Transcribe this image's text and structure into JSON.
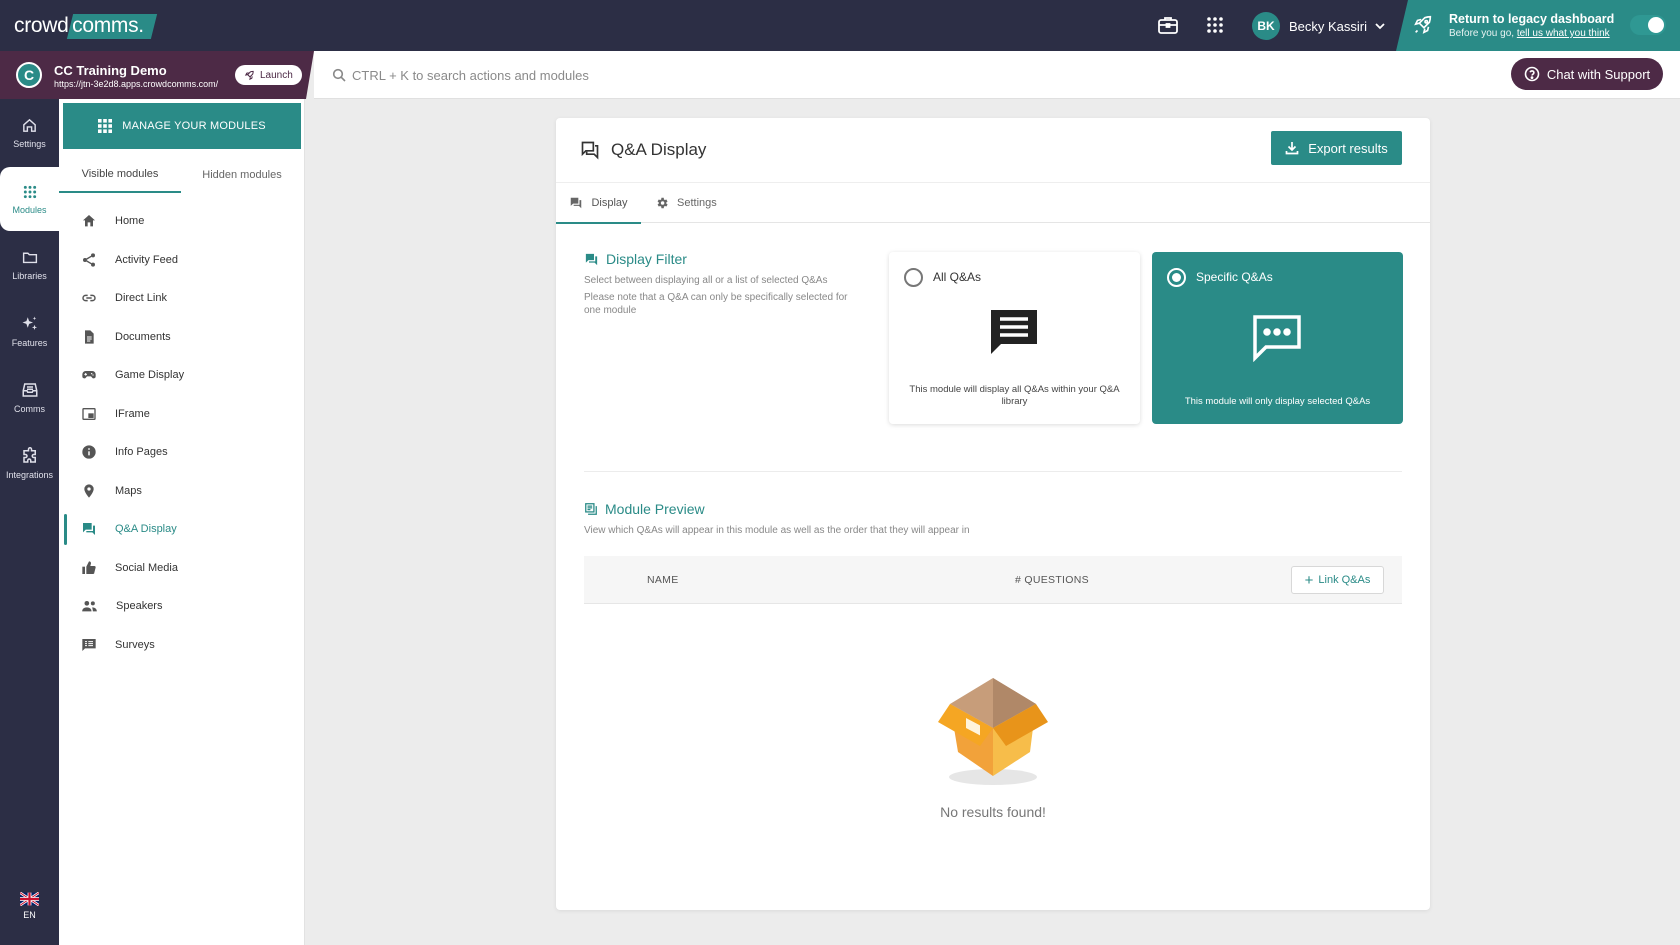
{
  "brand": {
    "logo_part1": "crowd",
    "logo_part2": "comms.",
    "accent": "#2a8b87",
    "topbar": "#2c2e45",
    "workspace_bg": "#4d2a46"
  },
  "topbar": {
    "user_initials": "BK",
    "user_name": "Becky Kassiri",
    "legacy_title": "Return to legacy dashboard",
    "legacy_sub_prefix": "Before you go, ",
    "legacy_sub_link": "tell us what you think"
  },
  "workspace": {
    "logo_letter": "C",
    "name": "CC Training Demo",
    "url": "https://jtn-3e2d8.apps.crowdcomms.com/",
    "launch_label": "Launch"
  },
  "search": {
    "placeholder": "CTRL + K to search actions and modules",
    "value": ""
  },
  "support": {
    "label": "Chat with Support"
  },
  "rail": {
    "items": [
      {
        "label": "Settings",
        "icon": "home-icon"
      },
      {
        "label": "Modules",
        "icon": "grid-icon"
      },
      {
        "label": "Libraries",
        "icon": "folder-icon"
      },
      {
        "label": "Features",
        "icon": "sparkle-icon"
      },
      {
        "label": "Comms",
        "icon": "inbox-icon"
      },
      {
        "label": "Integrations",
        "icon": "puzzle-icon"
      }
    ],
    "active_index": 1,
    "language": "EN"
  },
  "modules": {
    "manage_label": "MANAGE YOUR MODULES",
    "tabs": [
      "Visible modules",
      "Hidden modules"
    ],
    "items": [
      {
        "label": "Home",
        "icon": "home-icon"
      },
      {
        "label": "Activity Feed",
        "icon": "share-icon"
      },
      {
        "label": "Direct Link",
        "icon": "link-icon"
      },
      {
        "label": "Documents",
        "icon": "document-icon"
      },
      {
        "label": "Game Display",
        "icon": "gamepad-icon"
      },
      {
        "label": "IFrame",
        "icon": "iframe-icon"
      },
      {
        "label": "Info Pages",
        "icon": "info-icon"
      },
      {
        "label": "Maps",
        "icon": "map-pin-icon"
      },
      {
        "label": "Q&A Display",
        "icon": "qa-icon"
      },
      {
        "label": "Social Media",
        "icon": "thumbs-up-icon"
      },
      {
        "label": "Speakers",
        "icon": "people-icon"
      },
      {
        "label": "Surveys",
        "icon": "survey-icon"
      }
    ],
    "active_index": 8
  },
  "page": {
    "title": "Q&A Display",
    "export_label": "Export results",
    "tabs": [
      "Display",
      "Settings"
    ],
    "filter": {
      "title": "Display Filter",
      "desc1": "Select between displaying all or a list of selected Q&As",
      "desc2": "Please note that a Q&A can only be specifically selected for one module",
      "options": [
        {
          "label": "All Q&As",
          "desc": "This module will display all Q&As within your Q&A library",
          "selected": false
        },
        {
          "label": "Specific Q&As",
          "desc": "This module will only display selected Q&As",
          "selected": true
        }
      ]
    },
    "preview": {
      "title": "Module Preview",
      "desc": "View which Q&As will appear in this module as well as the order that they will appear in",
      "columns": [
        "NAME",
        "# QUESTIONS"
      ],
      "link_label": "Link Q&As",
      "empty_text": "No results found!"
    }
  }
}
